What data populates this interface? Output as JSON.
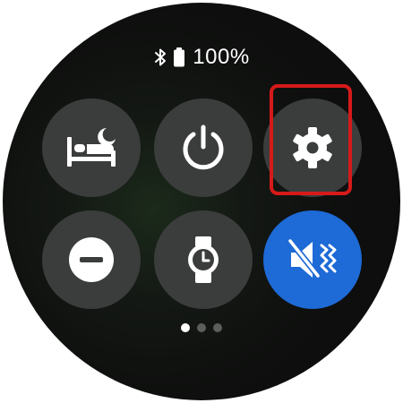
{
  "status_bar": {
    "bluetooth_icon": "bluetooth-icon",
    "battery_icon": "battery-icon",
    "battery_percent": "100%"
  },
  "quick_settings": {
    "tiles": [
      {
        "name": "bedtime-mode",
        "icon": "bed-moon-icon",
        "active": false
      },
      {
        "name": "power",
        "icon": "power-icon",
        "active": false
      },
      {
        "name": "settings",
        "icon": "gear-icon",
        "active": false,
        "highlighted": true
      },
      {
        "name": "do-not-disturb",
        "icon": "minus-circle-icon",
        "active": false
      },
      {
        "name": "watch-only",
        "icon": "watch-icon",
        "active": false
      },
      {
        "name": "sound-mute-vibrate",
        "icon": "mute-vibrate-icon",
        "active": true
      }
    ]
  },
  "pager": {
    "page_count": 3,
    "current_page": 1
  },
  "colors": {
    "tile_background": "#3b3d3c",
    "active_tile": "#1e6ad6",
    "highlight": "#d51a1a",
    "screen_background": "#0b0b0b"
  }
}
